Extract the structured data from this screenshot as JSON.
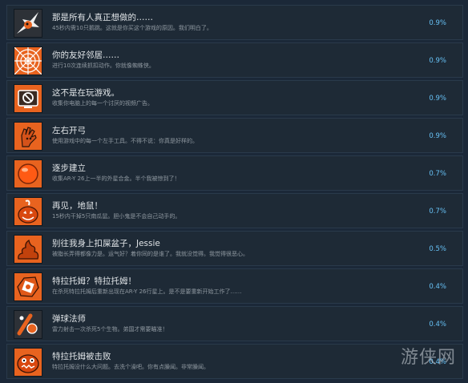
{
  "achievements": [
    {
      "title": "那是所有人真正想做的……",
      "desc": "45秒内需10只鹅跳。这就是你买这个游戏的原因。我们明白了。",
      "percent": "0.9%",
      "icon": "mascot-splash-icon"
    },
    {
      "title": "你的友好邻居……",
      "desc": "进行10次连续抓扣动作。你就像蜘蛛侠。",
      "percent": "0.9%",
      "icon": "spider-web-icon"
    },
    {
      "title": "这不是在玩游戏。",
      "desc": "收集你电脑上的每一个讨厌的视频广告。",
      "percent": "0.9%",
      "icon": "no-tv-icon"
    },
    {
      "title": "左右开弓",
      "desc": "使用游戏中的每一个左手工具。不得不说：你真是好样的。",
      "percent": "0.9%",
      "icon": "left-hand-icon"
    },
    {
      "title": "逐步建立",
      "desc": "收集AR-Y 26上一半的外星合金。半个我被惊到了！",
      "percent": "0.7%",
      "icon": "orange-orb-icon"
    },
    {
      "title": "再见，地鼠！",
      "desc": "15秒内干掉5只南瓜鼠。胆小鬼是不会自己动手的。",
      "percent": "0.7%",
      "icon": "pumpkin-icon"
    },
    {
      "title": "别往我身上扣屎盆子，Jessie",
      "desc": "被脂长弄得都像力是。运气好？着你同的是谁了。我就没觉得。我觉得很恶心。",
      "percent": "0.5%",
      "icon": "poop-icon"
    },
    {
      "title": "特拉托姆？特拉托姆！",
      "desc": "在杀死特拉托姆后重新出现在AR-Y 26行星上。是不是要重新开始工作了……",
      "percent": "0.4%",
      "icon": "tratom-icon"
    },
    {
      "title": "弹球法师",
      "desc": "雷力射击一次杀死5个生物。弟国才需要瞄准！",
      "percent": "0.4%",
      "icon": "pinball-wizard-icon"
    },
    {
      "title": "特拉托姆被击败",
      "desc": "特拉托姆没什么大问题。去洗个澡吧。你有点臊闻。非常臊闻。",
      "percent": "0.4%",
      "icon": "tratom-defeated-icon"
    }
  ],
  "watermark": "游侠网"
}
